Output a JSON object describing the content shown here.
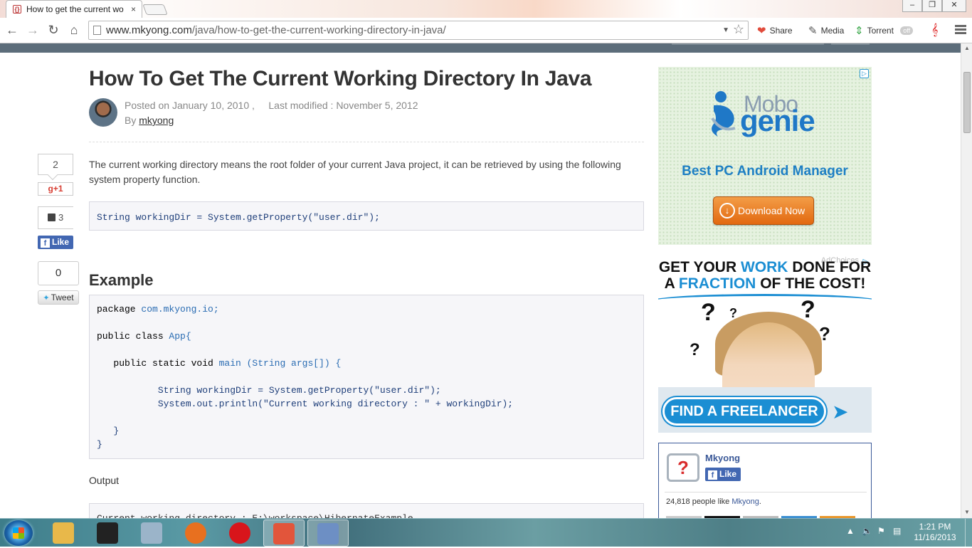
{
  "browser": {
    "tab_title": "How to get the current wo",
    "tab_close": "×",
    "url_host": "www.mkyong.com",
    "url_path": "/java/how-to-get-the-current-working-directory-in-java/",
    "extensions": [
      {
        "label": "Share",
        "icon": "heart-icon",
        "color": "#e14b3b"
      },
      {
        "label": "Media",
        "icon": "media-icon",
        "color": "#555555"
      },
      {
        "label": "Torrent",
        "icon": "torrent-icon",
        "color": "#3aa74a"
      }
    ],
    "torrent_badge": "off",
    "window_buttons": [
      "–",
      "❐",
      "✕"
    ]
  },
  "article": {
    "title": "How To Get The Current Working Directory In Java",
    "posted": "Posted on January 10, 2010 ,",
    "modified": "Last modified : November 5, 2012",
    "by_label": "By",
    "author": "mkyong",
    "intro": "The current working directory means the root folder of your current Java project, it can be retrieved by using the following system property function.",
    "snippet": "String workingDir = System.getProperty(\"user.dir\");",
    "example_heading": "Example",
    "example_code": [
      {
        "kw": "package",
        "rest": " com.mkyong.io;"
      },
      {
        "kw": "",
        "rest": ""
      },
      {
        "kw": "public class",
        "rest": " App{"
      },
      {
        "kw": "",
        "rest": ""
      },
      {
        "kw": "   public static void",
        "rest": " main (String args[]) {"
      },
      {
        "kw": "",
        "rest": ""
      },
      {
        "kw": "",
        "rest": "           String workingDir = System.getProperty(\"user.dir\");"
      },
      {
        "kw": "",
        "rest": "           System.out.println(\"Current working directory : \" + workingDir);"
      },
      {
        "kw": "",
        "rest": ""
      },
      {
        "kw": "",
        "rest": "   }"
      },
      {
        "kw": "",
        "rest": "}"
      }
    ],
    "output_label": "Output",
    "output_code": "Current working directory : E:\\workspace\\HibernateExample"
  },
  "share": {
    "gplus_count": "2",
    "gplus_label": "+1",
    "fb_count": "3",
    "fb_like": "Like",
    "tweet_count": "0",
    "tweet_label": "Tweet"
  },
  "ads": {
    "ad1": {
      "brand_top": "Mobo",
      "brand_bottom": "genie",
      "tagline": "Best PC Android Manager",
      "cta": "Download Now"
    },
    "ad2": {
      "adchoices": "AdChoices",
      "line1_a": "GET YOUR ",
      "line1_b": "WORK",
      "line1_c": " DONE FOR",
      "line2_a": "A ",
      "line2_b": "FRACTION",
      "line2_c": " OF THE ",
      "line2_d": "COST!",
      "cta": "FIND A FREELANCER"
    }
  },
  "fb_page": {
    "name": "Mkyong",
    "like": "Like",
    "count_text": "24,818 people like ",
    "count_link": "Mkyong",
    "count_end": "."
  },
  "taskbar": {
    "apps": [
      {
        "name": "explorer",
        "color": "#e8b84a"
      },
      {
        "name": "djrazor",
        "color": "#222222"
      },
      {
        "name": "calculator",
        "color": "#9bb4c9"
      },
      {
        "name": "firefox",
        "color": "#e8701f"
      },
      {
        "name": "opera",
        "color": "#d8151b"
      },
      {
        "name": "chrome-mod",
        "color": "#e2553b"
      },
      {
        "name": "virtualbox",
        "color": "#6d8fc4"
      }
    ],
    "time": "1:21 PM",
    "date": "11/16/2013"
  }
}
